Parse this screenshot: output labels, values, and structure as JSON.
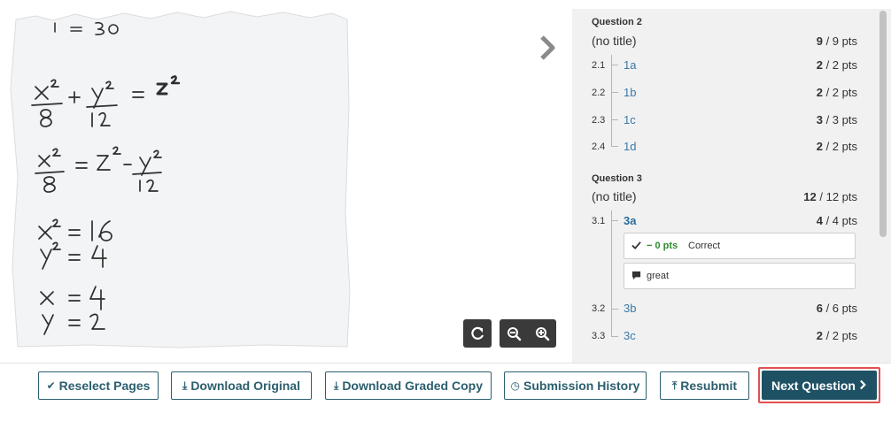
{
  "scan": {
    "lines": [
      {
        "text": "x² / 8  +  y² / 12  =  z²"
      },
      {
        "text": "x² / 8  =  z² − y² / 12"
      },
      {
        "text": "x² = 16"
      },
      {
        "text": "y² = 4"
      },
      {
        "text": "x = 4"
      },
      {
        "text": "y = 2"
      }
    ]
  },
  "viewer": {
    "next_arrow_icon": "chevron-right-icon",
    "rotate_icon": "rotate-icon",
    "zoom_out_icon": "zoom-out-icon",
    "zoom_in_icon": "zoom-in-icon"
  },
  "questions": [
    {
      "heading": "Question 2",
      "title": "(no title)",
      "score": "9",
      "max": " / 9 pts",
      "parts": [
        {
          "num": "2.1",
          "label": "1a",
          "score": "2",
          "max": " / 2 pts"
        },
        {
          "num": "2.2",
          "label": "1b",
          "score": "2",
          "max": " / 2 pts"
        },
        {
          "num": "2.3",
          "label": "1c",
          "score": "3",
          "max": " / 3 pts"
        },
        {
          "num": "2.4",
          "label": "1d",
          "score": "2",
          "max": " / 2 pts"
        }
      ]
    },
    {
      "heading": "Question 3",
      "title": "(no title)",
      "score": "12",
      "max": " / 12 pts",
      "parts": [
        {
          "num": "3.1",
          "label": "3a",
          "score": "4",
          "max": " / 4 pts"
        },
        {
          "num": "3.2",
          "label": "3b",
          "score": "6",
          "max": " / 6 pts"
        },
        {
          "num": "3.3",
          "label": "3c",
          "score": "2",
          "max": " / 2 pts"
        }
      ]
    }
  ],
  "rubric": {
    "points": "− 0 pts",
    "label": "Correct",
    "comment": "great"
  },
  "toolbar": {
    "reselect": "Reselect Pages",
    "download_original": "Download Original",
    "download_graded": "Download Graded Copy",
    "history": "Submission History",
    "resubmit": "Resubmit",
    "next_question": "Next Question"
  },
  "colors": {
    "accent": "#1f5164",
    "link": "#3a78a8",
    "correct": "#2e8b2e",
    "highlight": "#e05050"
  }
}
